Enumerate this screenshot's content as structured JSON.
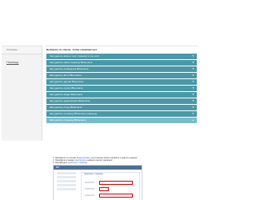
{
  "sidebar": {
    "header": "Описание",
    "link": "Помощь"
  },
  "main": {
    "heading": "Выберите из списка, чтобы ознакомиться",
    "bars": [
      {
        "label": "Как удалить вопрос или страницу в соц сети"
      },
      {
        "label": "Как удалить свою страницу ВКонтакте"
      },
      {
        "label": "Как удалить сообщения ВКонтакте"
      },
      {
        "label": "Как удалить фото ВКонтакте"
      },
      {
        "label": "Как удалить друзей ВКонтакте"
      },
      {
        "label": "Как удалить группу ВКонтакте"
      },
      {
        "label": "Как удалить видео ВКонтакте"
      },
      {
        "label": "Как удалить аудиозаписи ВКонтакте"
      },
      {
        "label": "Как удалить стену ВКонтакте"
      },
      {
        "label": "Как удалить страницу ВКонтакте навсегда"
      },
      {
        "label": "Как удалить страницу ВКонтакте"
      }
    ],
    "expanded": {
      "line1_text": "1. Перейдите по ссылке ",
      "line1_link": "Редактировать",
      "line1_rest": " на странице своего профиля и удалите данные",
      "line2_text": "2. Перейдите в раздел ",
      "line2_link": "Настройки",
      "line2_rest": " и найдите кнопку удаления",
      "line3_text": "3. Подтвердите ",
      "line3_link": "удаление страницы",
      "screenshot": {
        "bar_title": "ВК",
        "content_title": "Удаление страницы"
      }
    }
  }
}
